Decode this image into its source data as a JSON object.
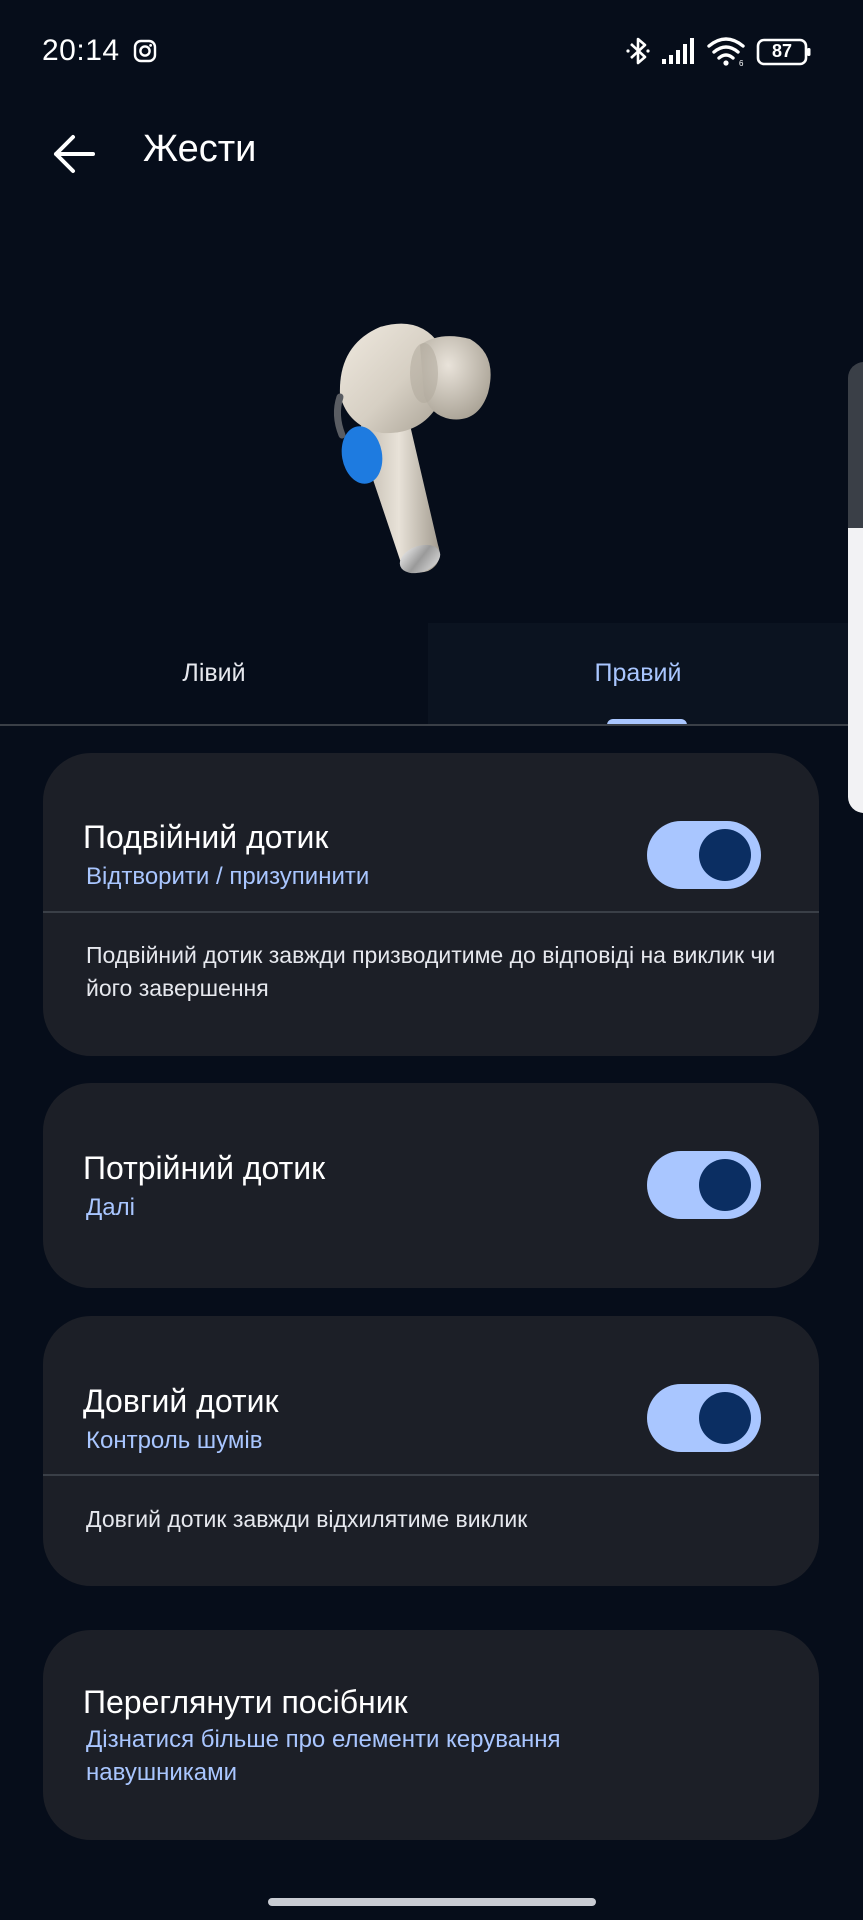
{
  "status_bar": {
    "time": "20:14",
    "battery": "87",
    "icons": [
      "instagram-icon",
      "bluetooth-icon",
      "signal-icon",
      "wifi-icon",
      "battery-icon"
    ]
  },
  "app_bar": {
    "title": "Жести",
    "back_icon": "arrow-left-icon"
  },
  "tabs": [
    {
      "label": "Лівий",
      "selected": false
    },
    {
      "label": "Правий",
      "selected": true
    }
  ],
  "cards": {
    "double_tap": {
      "title": "Подвійний дотик",
      "action": "Відтворити / призупинити",
      "toggle_on": true,
      "note": "Подвійний дотик завжди призводитиме до відповіді на виклик чи його завершення"
    },
    "triple_tap": {
      "title": "Потрійний дотик",
      "action": "Далі",
      "toggle_on": true
    },
    "long_press": {
      "title": "Довгий дотик",
      "action": "Контроль шумів",
      "toggle_on": true,
      "note": "Довгий дотик завжди відхилятиме виклик"
    },
    "guide": {
      "title": "Переглянути посібник",
      "subtitle": "Дізнатися більше про елементи керування навушниками"
    }
  },
  "colors": {
    "background": "#060d1a",
    "card": "#1c1f27",
    "accent": "#a9c6ff",
    "toggle_knob": "#0b2e62",
    "earbud_touch_zone": "#1e7be0"
  }
}
